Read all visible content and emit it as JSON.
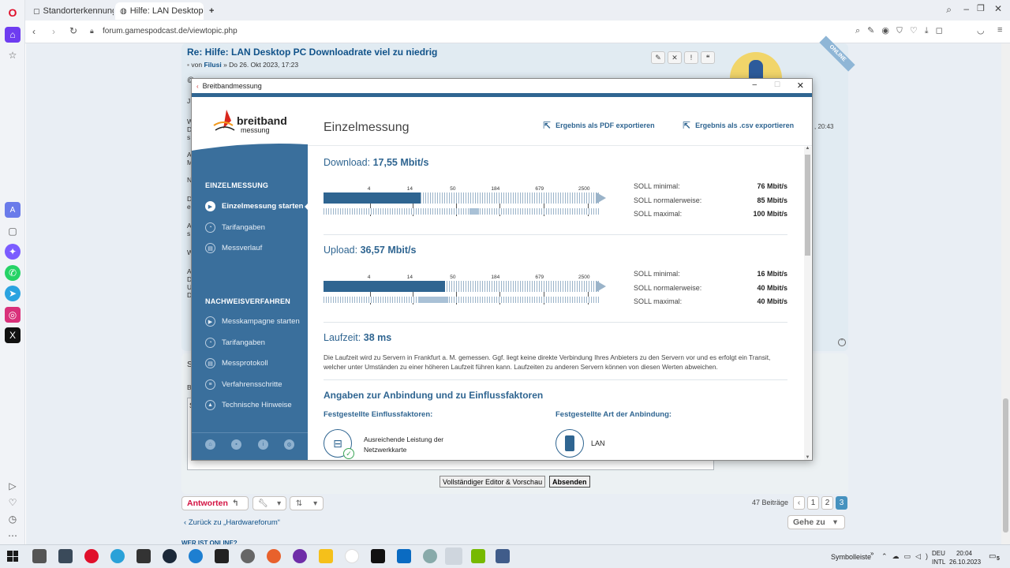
{
  "browser": {
    "tabs": [
      {
        "title": "Standorterkennung | Breit"
      },
      {
        "title": "Hilfe: LAN Desktop PC Do"
      }
    ],
    "new_tab": "+",
    "url": "forum.gamespodcast.de/viewtopic.php"
  },
  "forum": {
    "post_title": "Re: Hilfe: LAN Desktop PC Downloadrate viel zu niedrig",
    "post_by": "von",
    "post_author": "Filusi",
    "post_date": "» Do 26. Okt 2023, 17:23",
    "online_badge": "ONLINE",
    "side_time": ", 20:43",
    "left_letters": [
      "J",
      "W",
      "D",
      "s",
      "A",
      "M",
      "N",
      "D",
      "e",
      "A",
      "s",
      "W",
      "A",
      "D",
      "U",
      "D",
      "S",
      "B",
      "S"
    ],
    "full_editor_button": "Vollständiger Editor & Vorschau",
    "submit_button": "Absenden",
    "reply_button": "Antworten",
    "posts_count": "47 Beiträge",
    "pages": [
      "1",
      "2",
      "3"
    ],
    "back_link": "Zurück zu „Hardwareforum“",
    "goto_button": "Gehe zu",
    "who_online": "WER IST ONLINE?"
  },
  "dialog": {
    "title": "Breitbandmessung",
    "logo_text_1": "breitband",
    "logo_text_2": "messung",
    "sidebar": {
      "section1": "EINZELMESSUNG",
      "items1": [
        {
          "label": "Einzelmessung starten",
          "icon": "play-icon"
        },
        {
          "label": "Tarifangaben",
          "icon": "user-icon"
        },
        {
          "label": "Messverlauf",
          "icon": "history-icon"
        }
      ],
      "section2": "NACHWEISVERFAHREN",
      "items2": [
        {
          "label": "Messkampagne starten",
          "icon": "play-icon"
        },
        {
          "label": "Tarifangaben",
          "icon": "user-icon"
        },
        {
          "label": "Messprotokoll",
          "icon": "document-icon"
        },
        {
          "label": "Verfahrensschritte",
          "icon": "steps-icon"
        },
        {
          "label": "Technische Hinweise",
          "icon": "warning-icon"
        }
      ]
    },
    "main": {
      "heading": "Einzelmessung",
      "export_pdf": "Ergebnis als PDF exportieren",
      "export_csv": "Ergebnis als .csv exportieren",
      "download_label": "Download:",
      "download_value": "17,55 Mbit/s",
      "upload_label": "Upload:",
      "upload_value": "36,57 Mbit/s",
      "scale_ticks": [
        "4",
        "14",
        "50",
        "184",
        "679",
        "2500"
      ],
      "download_soll": [
        {
          "label": "SOLL minimal:",
          "value": "76 Mbit/s"
        },
        {
          "label": "SOLL normalerweise:",
          "value": "85 Mbit/s"
        },
        {
          "label": "SOLL maximal:",
          "value": "100 Mbit/s"
        }
      ],
      "upload_soll": [
        {
          "label": "SOLL minimal:",
          "value": "16 Mbit/s"
        },
        {
          "label": "SOLL normalerweise:",
          "value": "40 Mbit/s"
        },
        {
          "label": "SOLL maximal:",
          "value": "40 Mbit/s"
        }
      ],
      "latency_label": "Laufzeit:",
      "latency_value": "38 ms",
      "latency_text": "Die Laufzeit wird zu Servern in Frankfurt a. M. gemessen. Ggf. liegt keine direkte Verbindung Ihres Anbieters zu den Servern vor und es erfolgt ein Transit, welcher unter Umständen zu einer höheren Laufzeit führen kann. Laufzeiten zu anderen Servern können von diesen Werten abweichen.",
      "connection_heading": "Angaben zur Anbindung und zu Einflussfaktoren",
      "factors_heading": "Festgestellte Einflussfaktoren:",
      "factor_1a": "Ausreichende Leistung der",
      "factor_1b": "Netzwerkkarte",
      "conn_type_heading": "Festgestellte Art der Anbindung:",
      "conn_type": "LAN"
    }
  },
  "taskbar": {
    "symbolleiste": "Symbolleiste",
    "lang1": "DEU",
    "lang2": "INTL",
    "time": "20:04",
    "date": "26.10.2023",
    "notifications": "5"
  }
}
